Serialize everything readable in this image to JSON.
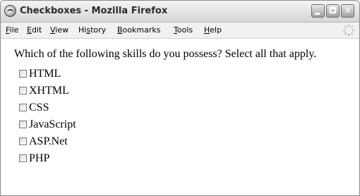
{
  "window": {
    "title": "Checkboxes - Mozilla Firefox",
    "menu": [
      {
        "accel": "F",
        "rest": "ile"
      },
      {
        "accel": "E",
        "rest": "dit"
      },
      {
        "accel": "V",
        "rest": "iew"
      },
      {
        "pre": "Hi",
        "accel": "s",
        "rest": "tory"
      },
      {
        "accel": "B",
        "rest": "ookmarks"
      },
      {
        "accel": "T",
        "rest": "ools"
      },
      {
        "accel": "H",
        "rest": "elp"
      }
    ]
  },
  "page": {
    "question": "Which of the following skills do you possess? Select all that apply.",
    "options": [
      "HTML",
      "XHTML",
      "CSS",
      "JavaScript",
      "ASP.Net",
      "PHP"
    ],
    "checked": [
      false,
      false,
      false,
      false,
      false,
      false
    ]
  },
  "icons": {
    "app": "firefox-icon",
    "minimize": "minimize-icon",
    "maximize": "maximize-icon",
    "close": "close-icon",
    "throbber": "activity-throbber-icon"
  }
}
